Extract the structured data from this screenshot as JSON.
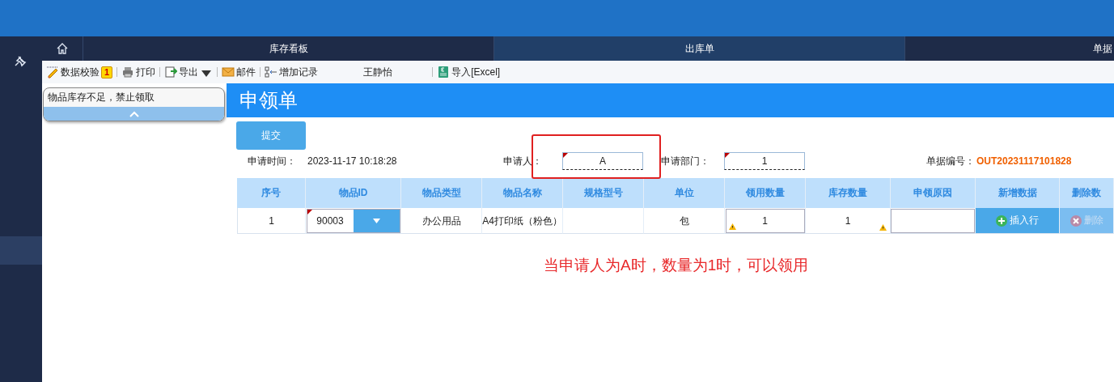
{
  "sidebar": {
    "items": [
      {
        "selected": true
      }
    ]
  },
  "nav_tabs": [
    {
      "kind": "home",
      "selected": false
    },
    {
      "kind": "text",
      "label": "库存看板",
      "selected": false
    },
    {
      "kind": "text",
      "label": "出库单",
      "selected": true
    },
    {
      "kind": "text",
      "label": "单据",
      "selected": false
    }
  ],
  "toolbar": [
    {
      "kind": "validate",
      "label": "数据校验",
      "badge": "1"
    },
    {
      "kind": "print",
      "label": "打印"
    },
    {
      "kind": "export",
      "label": "导出"
    },
    {
      "kind": "mail",
      "label": "邮件"
    },
    {
      "kind": "add",
      "label": "增加记录"
    },
    {
      "kind": "user",
      "label": "王静怡"
    },
    {
      "kind": "excel",
      "label": "导入[Excel]"
    }
  ],
  "validation_popup": {
    "message": "物品库存不足，禁止领取"
  },
  "form": {
    "title": "申领单",
    "submit": "提交",
    "fields": [
      {
        "kind": "text",
        "label": "申请时间：",
        "value": "2023-11-17 10:18:28"
      },
      {
        "kind": "input",
        "label": "申请人：",
        "value": "A",
        "highlighted": true
      },
      {
        "kind": "input",
        "label": "申请部门：",
        "value": "1"
      },
      {
        "kind": "code",
        "label": "单据编号：",
        "value": "OUT20231117101828"
      }
    ]
  },
  "table": {
    "columns": [
      "序号",
      "物品ID",
      "物品类型",
      "物品名称",
      "规格型号",
      "单位",
      "领用数量",
      "库存数量",
      "申领原因",
      "新增数据",
      "删除数"
    ],
    "rows": [
      {
        "cells": [
          {
            "kind": "text",
            "value": "1"
          },
          {
            "kind": "select",
            "value": "90003"
          },
          {
            "kind": "text",
            "value": "办公用品"
          },
          {
            "kind": "text",
            "value": "A4打印纸（粉色）"
          },
          {
            "kind": "text"
          },
          {
            "kind": "text",
            "value": "包"
          },
          {
            "kind": "input",
            "value": "1",
            "warning": true
          },
          {
            "kind": "text",
            "value": "1",
            "warning": true
          },
          {
            "kind": "input"
          },
          {
            "kind": "insert_button",
            "value": "插入行",
            "disabled": false
          },
          {
            "kind": "delete_button",
            "value": "删除",
            "disabled": true
          }
        ]
      }
    ]
  },
  "annotation": "当申请人为A时，数量为1时，可以领用"
}
